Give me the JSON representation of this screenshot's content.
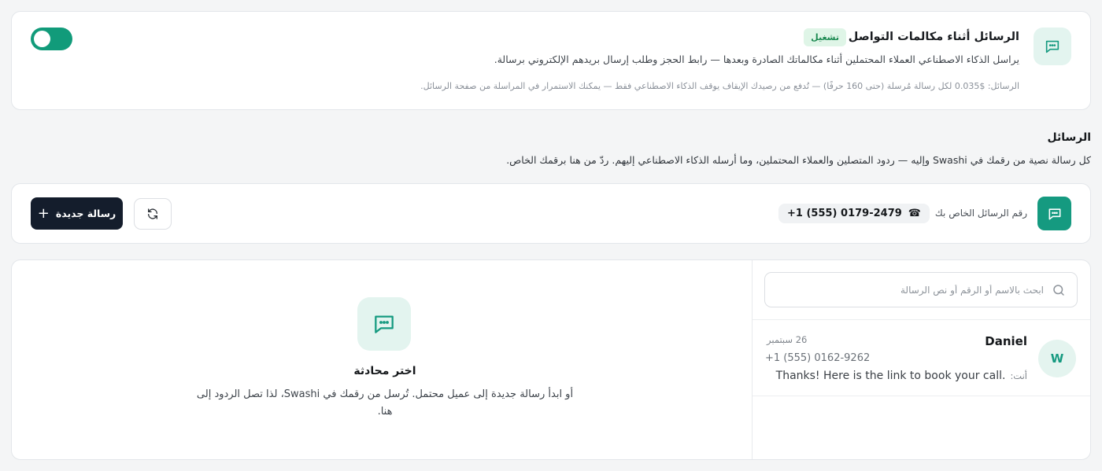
{
  "top_card": {
    "title": "الرسائل أثناء مكالمات التواصل",
    "badge": "تشغيل",
    "description": "يراسل الذكاء الاصطناعي العملاء المحتملين أثناء مكالماتك الصادرة وبعدها — رابط الحجز وطلب إرسال بريدهم الإلكتروني برسالة.",
    "note": "الرسائل: $0.035 لكل رسالة مُرسلة (حتى 160 حرفًا) — تُدفع من رصيدك   الإيقاف يوقف الذكاء الاصطناعي فقط — يمكنك الاستمرار في المراسلة من صفحة الرسائل.",
    "toggle_on": true
  },
  "section": {
    "title": "الرسائل",
    "description": "كل رسالة نصية من رقمك في Swashi وإليه — ردود المتصلين والعملاء المحتملين، وما أرسله الذكاء الاصطناعي إليهم. ردّ من هنا برقمك الخاص."
  },
  "number_bar": {
    "label": "رقم الرسائل الخاص بك",
    "phone": "+1 (555) 0179-2479",
    "phone_icon": "☎",
    "new_message_label": "رسالة جديدة",
    "new_message_icon": "+"
  },
  "search": {
    "placeholder": "ابحث بالاسم أو الرقم أو نص الرسالة",
    "value": ""
  },
  "conversations": [
    {
      "avatar": "W",
      "name": "Daniel",
      "date": "26 سبتمبر",
      "phone": "+1 (555) 0162-9262",
      "preview_prefix": "أنت:",
      "preview": "Thanks! Here is the link to book your call."
    }
  ],
  "empty_state": {
    "title": "اختر محادثة",
    "description": "أو ابدأ رسالة جديدة إلى عميل محتمل. تُرسل من رقمك في Swashi، لذا تصل الردود إلى هنا."
  },
  "colors": {
    "accent": "#159a80",
    "accent_light": "#e3f4ef",
    "badge_bg": "#dff5e7",
    "badge_text": "#1d8a52",
    "primary_button": "#141d2c"
  }
}
